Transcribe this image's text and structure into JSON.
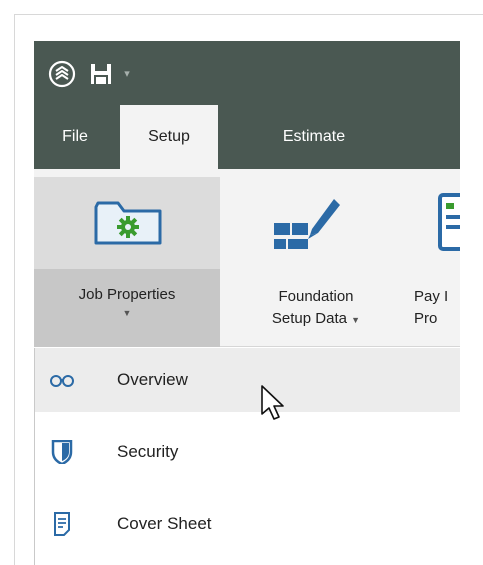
{
  "quick_access": {
    "logo_icon": "app-logo-icon",
    "save_icon": "save-icon",
    "dropdown_glyph": "▾"
  },
  "tabs": [
    {
      "label": "File"
    },
    {
      "label": "Setup"
    },
    {
      "label": "Estimate"
    }
  ],
  "ribbon": {
    "job_properties": {
      "label": "Job Properties",
      "icon": "folder-gear-icon"
    },
    "foundation_setup": {
      "line1": "Foundation",
      "line2": "Setup Data",
      "icon": "foundation-pencil-icon"
    },
    "pay_item": {
      "line1": "Pay I",
      "line2": "Pro",
      "icon": "pay-item-icon"
    }
  },
  "menu": {
    "items": [
      {
        "label": "Overview",
        "icon": "glasses-icon"
      },
      {
        "label": "Security",
        "icon": "shield-icon"
      },
      {
        "label": "Cover Sheet",
        "icon": "document-icon"
      }
    ]
  },
  "colors": {
    "titlebar": "#4a5852",
    "accent_green": "#3a9b2e",
    "icon_blue": "#2b6aa6",
    "ribbon_bg": "#f3f3f3"
  }
}
